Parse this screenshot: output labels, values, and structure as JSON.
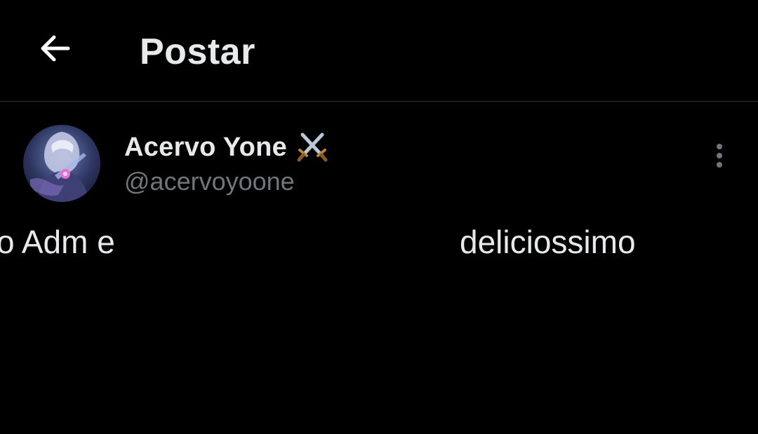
{
  "header": {
    "title": "Postar",
    "back_icon": "arrow-left-icon"
  },
  "post": {
    "author_name": "Acervo Yone",
    "author_emoji": "crossed-swords-icon",
    "handle": "@acervoyoone",
    "more_icon": "more-vertical-icon",
    "text_fragments": [
      "o Adm e",
      "deliciossimo"
    ]
  },
  "colors": {
    "background": "#000000",
    "primary_text": "#e7e9ea",
    "secondary_text": "#71767b",
    "divider": "#2f3336"
  }
}
